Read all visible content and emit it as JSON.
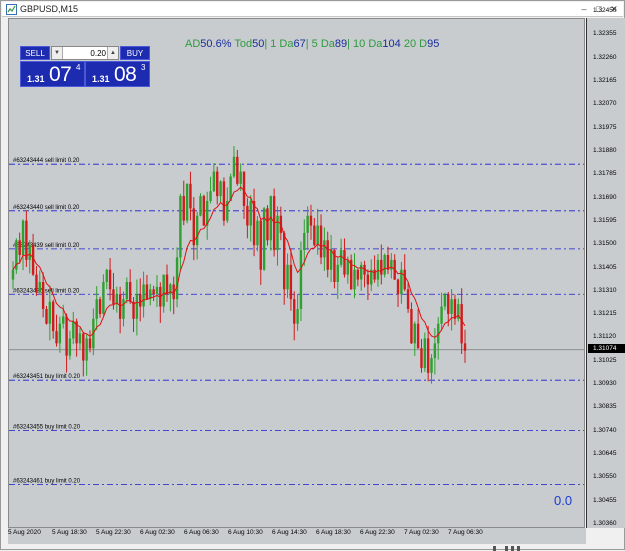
{
  "window": {
    "title": "GBPUSD,M15"
  },
  "trade_panel": {
    "sell_label": "SELL",
    "buy_label": "BUY",
    "lot_value": "0.20",
    "bid": {
      "prefix": "1.31",
      "big": "07",
      "sup": "4"
    },
    "ask": {
      "prefix": "1.31",
      "big": "08",
      "sup": "3"
    }
  },
  "stats": {
    "ad_label": "AD",
    "ad_value": "50.6%",
    "today_label": " Tod",
    "today_value": "50",
    "d1_label": "| 1 Da",
    "d1_value": "67",
    "d5_label": "| 5 Da",
    "d5_value": "89",
    "d10_label": "| 10 Da",
    "d10_value": "104",
    "d20_label": "  20 D",
    "d20_value": "95"
  },
  "corner_value": "0.0",
  "current_price": "1.31074",
  "price_scale": [
    "1.32450",
    "1.32355",
    "1.32260",
    "1.32165",
    "1.32070",
    "1.31975",
    "1.31880",
    "1.31785",
    "1.31690",
    "1.31595",
    "1.31500",
    "1.31405",
    "1.31310",
    "1.31215",
    "1.31120",
    "1.31025",
    "1.30930",
    "1.30835",
    "1.30740",
    "1.30645",
    "1.30550",
    "1.30455",
    "1.30360"
  ],
  "time_scale": [
    "5 Aug 2020",
    "5 Aug 18:30",
    "5 Aug 22:30",
    "6 Aug 02:30",
    "6 Aug 06:30",
    "6 Aug 10:30",
    "6 Aug 14:30",
    "6 Aug 18:30",
    "6 Aug 22:30",
    "7 Aug 02:30",
    "7 Aug 06:30"
  ],
  "orders": [
    {
      "label": "#63243444 sell limit 0.20",
      "price": 1.3183
    },
    {
      "label": "#63243440 sell limit 0.20",
      "price": 1.3164
    },
    {
      "label": "#63243439 sell limit 0.20",
      "price": 1.31485
    },
    {
      "label": "#63243436 sell limit 0.20",
      "price": 1.313
    },
    {
      "label": "#63243451 buy limit 0.20",
      "price": 1.3095
    },
    {
      "label": "#63243455 buy limit 0.20",
      "price": 1.30745
    },
    {
      "label": "#63243461 buy limit 0.20",
      "price": 1.30525
    }
  ],
  "colors": {
    "chart_bg": "#c8cccf",
    "bull": "#2ea02e",
    "bear": "#d11a1a",
    "ma": "#e01010",
    "order_line": "#1a1ad0",
    "panel_blue": "#1d2bb0"
  },
  "chart_data": {
    "type": "candlestick",
    "symbol": "GBPUSD",
    "timeframe": "M15",
    "ylim": [
      1.3036,
      1.3245
    ],
    "closes": [
      1.314,
      1.3152,
      1.3146,
      1.316,
      1.3144,
      1.315,
      1.3138,
      1.3131,
      1.3135,
      1.3124,
      1.3118,
      1.3127,
      1.3115,
      1.311,
      1.3118,
      1.3121,
      1.3105,
      1.3112,
      1.3119,
      1.311,
      1.3114,
      1.3103,
      1.3112,
      1.3108,
      1.312,
      1.3128,
      1.3122,
      1.3135,
      1.314,
      1.3132,
      1.3126,
      1.313,
      1.312,
      1.3128,
      1.3135,
      1.3127,
      1.312,
      1.313,
      1.3125,
      1.3134,
      1.3128,
      1.3132,
      1.313,
      1.3133,
      1.3125,
      1.3138,
      1.313,
      1.3134,
      1.3128,
      1.3145,
      1.317,
      1.316,
      1.3175,
      1.3165,
      1.315,
      1.3162,
      1.317,
      1.3158,
      1.3168,
      1.3172,
      1.318,
      1.317,
      1.3176,
      1.316,
      1.3168,
      1.3178,
      1.3186,
      1.3175,
      1.318,
      1.3166,
      1.3158,
      1.3168,
      1.315,
      1.316,
      1.314,
      1.3165,
      1.3152,
      1.317,
      1.3148,
      1.3162,
      1.3155,
      1.3132,
      1.3142,
      1.3128,
      1.3118,
      1.3124,
      1.3148,
      1.3155,
      1.3162,
      1.3158,
      1.315,
      1.3158,
      1.3145,
      1.3152,
      1.314,
      1.3148,
      1.3135,
      1.3142,
      1.3148,
      1.3138,
      1.3144,
      1.3132,
      1.314,
      1.3136,
      1.3142,
      1.3138,
      1.3134,
      1.314,
      1.3136,
      1.3144,
      1.3138,
      1.3146,
      1.314,
      1.3144,
      1.3136,
      1.313,
      1.314,
      1.3132,
      1.3124,
      1.311,
      1.3118,
      1.3108,
      1.31,
      1.3112,
      1.3098,
      1.3104,
      1.311,
      1.3118,
      1.3125,
      1.313,
      1.3122,
      1.3128,
      1.312,
      1.3126,
      1.311,
      1.3107
    ]
  }
}
